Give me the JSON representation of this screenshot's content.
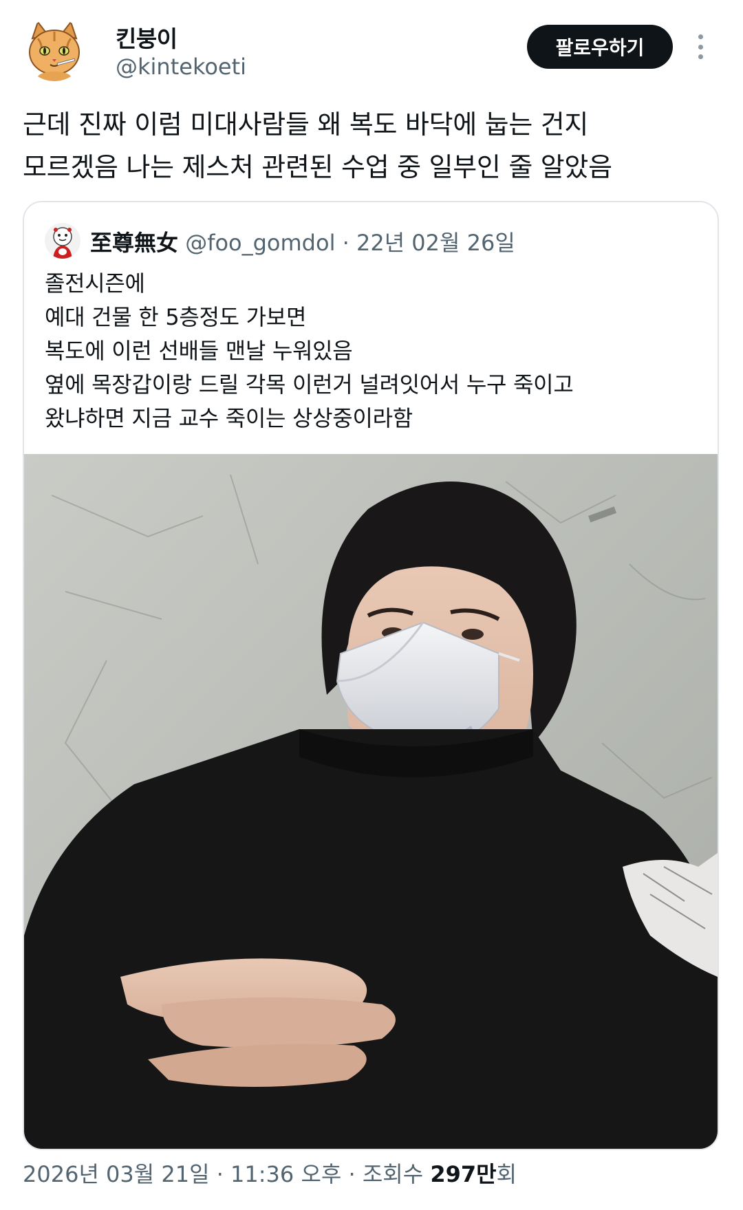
{
  "author": {
    "name": "킨붕이",
    "handle": "@kintekoeti",
    "avatar_icon": "cat-avatar-icon"
  },
  "actions": {
    "follow_label": "팔로우하기",
    "more_icon": "more-vertical-icon"
  },
  "tweet": {
    "lines": [
      "근데 진짜 이럼 미대사람들 왜 복도 바닥에 눕는 건지",
      "모르겠음 나는 제스처 관련된 수업 중 일부인 줄 알았음"
    ]
  },
  "quote": {
    "name": "至尊無女",
    "handle": "@foo_gomdol",
    "separator": "·",
    "date": "22년 02월 26일",
    "avatar_icon": "character-avatar-icon",
    "lines": [
      "졸전시즌에",
      "예대 건물 한 5층정도 가보면",
      "복도에 이런 선배들 맨날 누워있음",
      "옆에 목장갑이랑 드릴 각목 이런거 널려잇어서 누구 죽이고",
      "왔냐하면 지금 교수 죽이는 상상중이라함"
    ],
    "media": "photo-man-lying-on-floor-white-mask"
  },
  "footer": {
    "datetime": "2026년 03월 21일 · 11:36 오후 · 조회수 ",
    "views_number": "297만",
    "views_suffix": "회"
  },
  "colors": {
    "text_primary": "#0f1419",
    "text_secondary": "#536471",
    "button_bg": "#0f1419",
    "border": "#e1e5ea"
  }
}
